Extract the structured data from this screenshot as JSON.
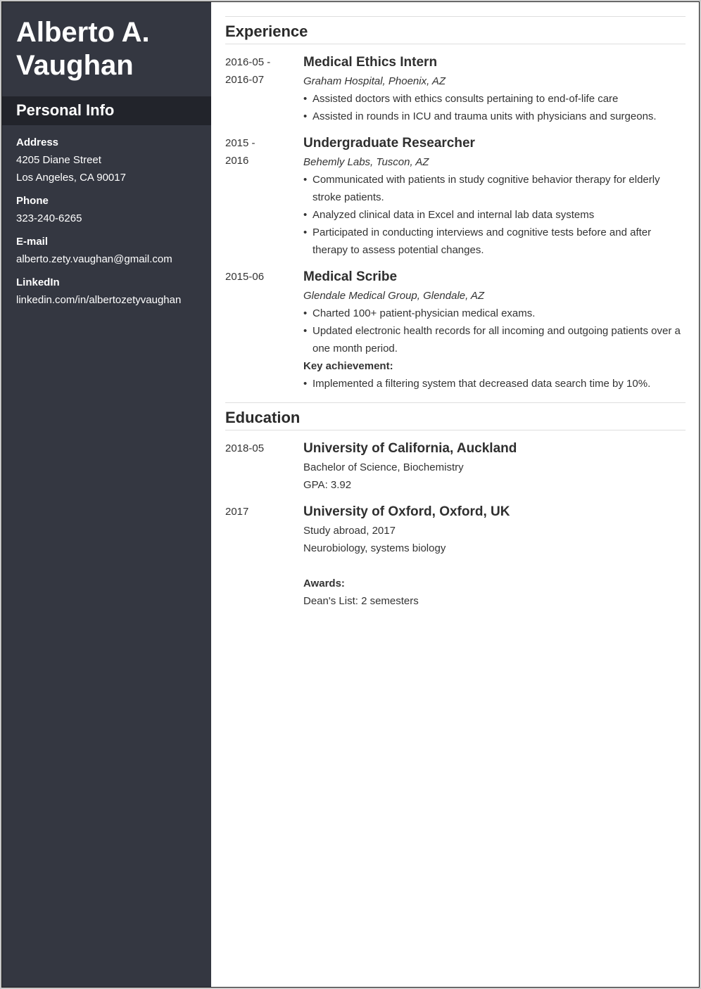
{
  "sidebar": {
    "name_line1": "Alberto A.",
    "name_line2": "Vaughan",
    "section_title": "Personal Info",
    "fields": [
      {
        "label": "Address",
        "values": [
          "4205 Diane Street",
          "Los Angeles, CA 90017"
        ]
      },
      {
        "label": "Phone",
        "values": [
          "323-240-6265"
        ]
      },
      {
        "label": "E-mail",
        "values": [
          "alberto.zety.vaughan@gmail.com"
        ]
      },
      {
        "label": "LinkedIn",
        "values": [
          "linkedin.com/in/albertozetyvaughan"
        ]
      }
    ]
  },
  "experience": {
    "title": "Experience",
    "entries": [
      {
        "date_line1": "2016-05 -",
        "date_line2": "2016-07",
        "title": "Medical Ethics Intern",
        "org": "Graham Hospital, Phoenix, AZ",
        "bullets": [
          "Assisted doctors with ethics consults pertaining to end-of-life care",
          "Assisted in rounds in ICU and trauma units with physicians and surgeons."
        ]
      },
      {
        "date_line1": "2015 -",
        "date_line2": "2016",
        "title": "Undergraduate Researcher",
        "org": "Behemly Labs, Tuscon, AZ",
        "bullets": [
          "Communicated with patients in study cognitive behavior therapy for elderly stroke patients.",
          "Analyzed clinical data in Excel and internal lab data systems",
          "Participated in conducting interviews and cognitive tests before and after therapy to assess potential changes."
        ]
      },
      {
        "date_line1": "2015-06",
        "title": "Medical Scribe",
        "org": "Glendale Medical Group, Glendale, AZ",
        "bullets": [
          "Charted 100+ patient-physician medical exams.",
          "Updated electronic health records for all incoming and outgoing patients over a one month period."
        ],
        "key_label": "Key achievement:",
        "key_bullets": [
          "Implemented a filtering system that decreased data search time by 10%."
        ]
      }
    ]
  },
  "education": {
    "title": "Education",
    "entries": [
      {
        "date": "2018-05",
        "title": "University of California, Auckland",
        "lines": [
          "Bachelor of Science, Biochemistry",
          "GPA: 3.92"
        ]
      },
      {
        "date": "2017",
        "title": "University of Oxford, Oxford, UK",
        "lines": [
          "Study abroad, 2017",
          "Neurobiology, systems biology"
        ],
        "awards_label": "Awards:",
        "awards": [
          "Dean's List: 2 semesters"
        ]
      }
    ]
  }
}
